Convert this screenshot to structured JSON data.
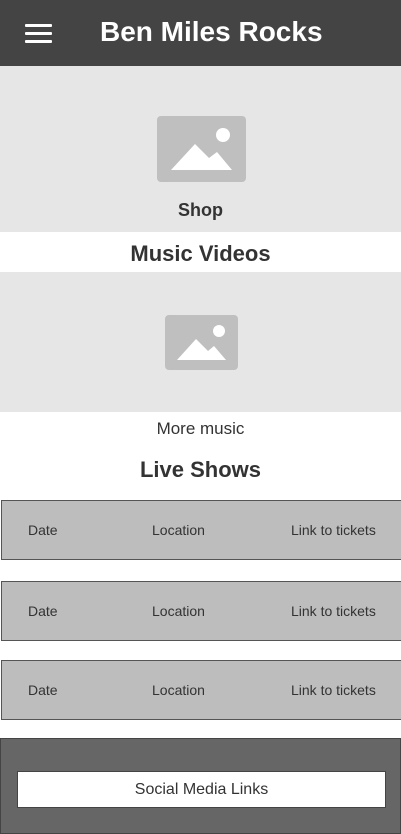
{
  "header": {
    "title": "Ben Miles Rocks",
    "menu_icon": "hamburger-menu-icon"
  },
  "shop": {
    "label": "Shop",
    "image_icon": "image-placeholder-icon"
  },
  "music_videos": {
    "heading": "Music Videos",
    "image_icon": "image-placeholder-icon",
    "more_label": "More music"
  },
  "live_shows": {
    "heading": "Live Shows",
    "rows": [
      {
        "date": "Date",
        "location": "Location",
        "tickets": "Link to tickets"
      },
      {
        "date": "Date",
        "location": "Location",
        "tickets": "Link to tickets"
      },
      {
        "date": "Date",
        "location": "Location",
        "tickets": "Link to tickets"
      }
    ]
  },
  "footer": {
    "social_label": "Social Media Links"
  },
  "colors": {
    "header_bg": "#444444",
    "placeholder_bg": "#e6e6e6",
    "placeholder_icon": "#bfbfbf",
    "row_bg": "#bdbdbd",
    "footer_bg": "#666666"
  }
}
